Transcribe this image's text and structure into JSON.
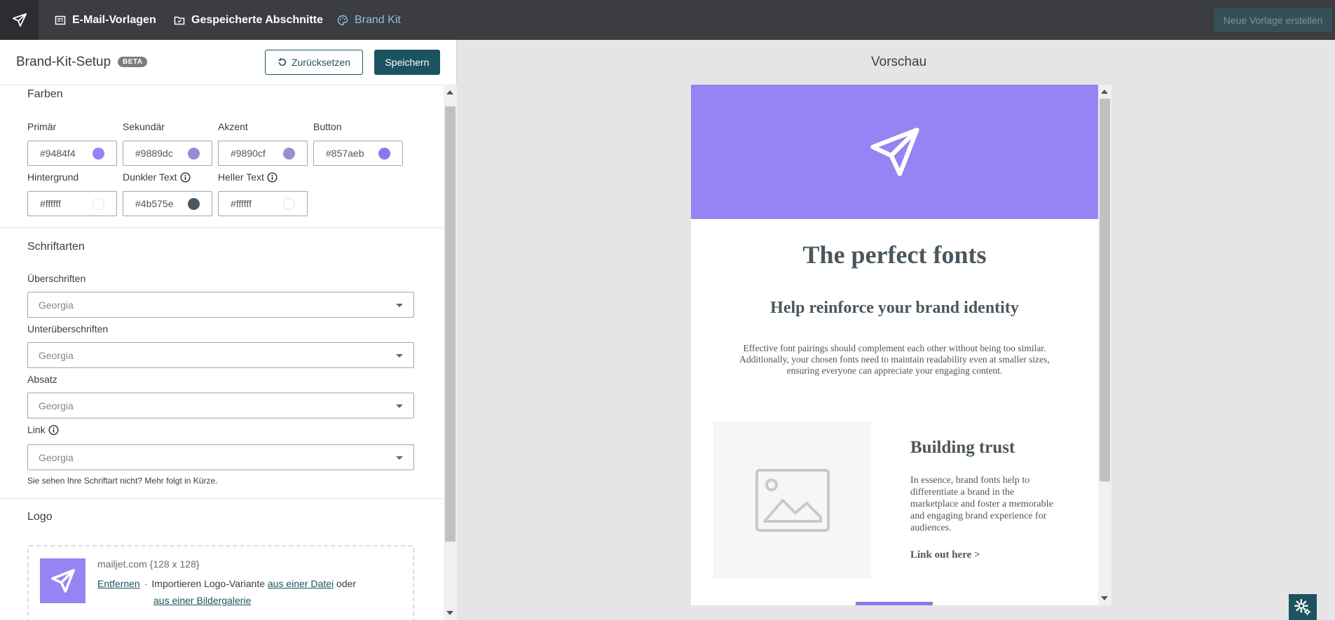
{
  "topbar": {
    "nav": [
      {
        "label": "E-Mail-Vorlagen",
        "icon": "template-icon"
      },
      {
        "label": "Gespeicherte Abschnitte",
        "icon": "saved-folder-icon"
      },
      {
        "label": "Brand Kit",
        "icon": "palette-icon",
        "active": true
      }
    ],
    "new_template_label": "Neue Vorlage erstellen"
  },
  "setup": {
    "title": "Brand-Kit-Setup",
    "badge": "BETA",
    "reset_label": "Zurücksetzen",
    "save_label": "Speichern"
  },
  "colors": {
    "title": "Farben",
    "fields": [
      {
        "label": "Primär",
        "value": "#9484f4",
        "swatch": "#9484f4"
      },
      {
        "label": "Sekundär",
        "value": "#9889dc",
        "swatch": "#9889dc"
      },
      {
        "label": "Akzent",
        "value": "#9890cf",
        "swatch": "#9890cf"
      },
      {
        "label": "Button",
        "value": "#857aeb",
        "swatch": "#857aeb"
      },
      {
        "label": "Hintergrund",
        "value": "#ffffff",
        "swatch": "#ffffff"
      },
      {
        "label": "Dunkler Text",
        "value": "#4b575e",
        "swatch": "#4b575e"
      },
      {
        "label": "Heller Text",
        "value": "#ffffff",
        "swatch": "#ffffff"
      }
    ]
  },
  "fonts": {
    "title": "Schriftarten",
    "fields": [
      {
        "label": "Überschriften",
        "value": "Georgia"
      },
      {
        "label": "Unterüberschriften",
        "value": "Georgia"
      },
      {
        "label": "Absatz",
        "value": "Georgia"
      },
      {
        "label": "Link",
        "value": "Georgia"
      }
    ],
    "note": "Sie sehen Ihre Schriftart nicht? Mehr folgt in Kürze."
  },
  "logo": {
    "title": "Logo",
    "meta": "mailjet.com {128 x 128}",
    "remove": "Entfernen",
    "import_text": "Importieren Logo-Variante",
    "from_file": "aus einer Datei",
    "or": "oder",
    "from_gallery": "aus einer Bildergalerie"
  },
  "preview": {
    "title": "Vorschau",
    "h1": "The perfect fonts",
    "h2": "Help reinforce your brand identity",
    "paragraph": "Effective font pairings should complement each other without being too similar. Additionally, your chosen fonts need to maintain readability even at smaller sizes, ensuring everyone can appreciate your engaging content.",
    "h3": "Building trust",
    "paragraph2": "In essence, brand fonts help to differentiate a brand in the marketplace and foster a memorable and engaging brand experience for audiences.",
    "link": "Link out here >",
    "header_color": "#9484f4",
    "text_color": "#4b575e"
  }
}
